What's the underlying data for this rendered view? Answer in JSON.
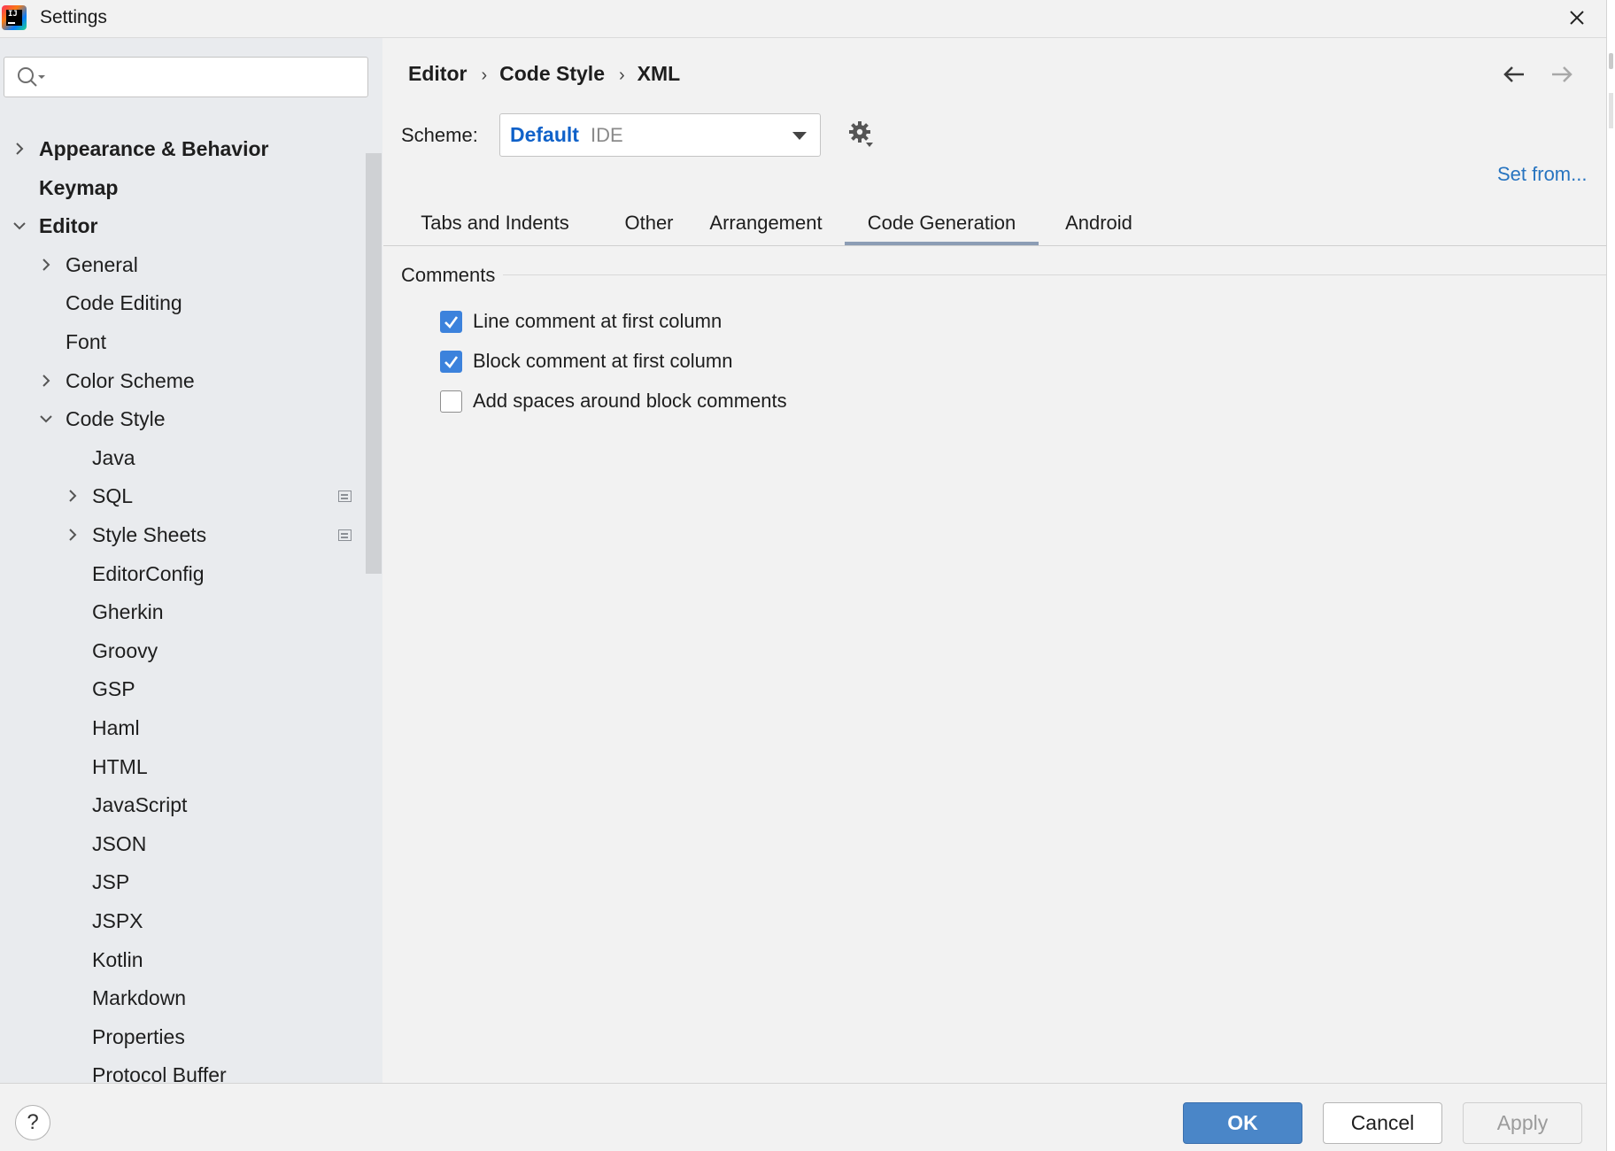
{
  "window": {
    "title": "Settings"
  },
  "search": {
    "placeholder": "",
    "value": ""
  },
  "sidebar": {
    "items": [
      {
        "label": "Appearance & Behavior",
        "level": 0,
        "expandable": true,
        "expanded": false,
        "bold": true,
        "project": false
      },
      {
        "label": "Keymap",
        "level": 0,
        "expandable": false,
        "expanded": false,
        "bold": true,
        "project": false
      },
      {
        "label": "Editor",
        "level": 0,
        "expandable": true,
        "expanded": true,
        "bold": true,
        "project": false
      },
      {
        "label": "General",
        "level": 1,
        "expandable": true,
        "expanded": false,
        "bold": false,
        "project": false
      },
      {
        "label": "Code Editing",
        "level": 1,
        "expandable": false,
        "expanded": false,
        "bold": false,
        "project": false
      },
      {
        "label": "Font",
        "level": 1,
        "expandable": false,
        "expanded": false,
        "bold": false,
        "project": false
      },
      {
        "label": "Color Scheme",
        "level": 1,
        "expandable": true,
        "expanded": false,
        "bold": false,
        "project": false
      },
      {
        "label": "Code Style",
        "level": 1,
        "expandable": true,
        "expanded": true,
        "bold": false,
        "project": false
      },
      {
        "label": "Java",
        "level": 2,
        "expandable": false,
        "expanded": false,
        "bold": false,
        "project": false
      },
      {
        "label": "SQL",
        "level": 2,
        "expandable": true,
        "expanded": false,
        "bold": false,
        "project": true
      },
      {
        "label": "Style Sheets",
        "level": 2,
        "expandable": true,
        "expanded": false,
        "bold": false,
        "project": true
      },
      {
        "label": "EditorConfig",
        "level": 2,
        "expandable": false,
        "expanded": false,
        "bold": false,
        "project": false
      },
      {
        "label": "Gherkin",
        "level": 2,
        "expandable": false,
        "expanded": false,
        "bold": false,
        "project": false
      },
      {
        "label": "Groovy",
        "level": 2,
        "expandable": false,
        "expanded": false,
        "bold": false,
        "project": false
      },
      {
        "label": "GSP",
        "level": 2,
        "expandable": false,
        "expanded": false,
        "bold": false,
        "project": false
      },
      {
        "label": "Haml",
        "level": 2,
        "expandable": false,
        "expanded": false,
        "bold": false,
        "project": false
      },
      {
        "label": "HTML",
        "level": 2,
        "expandable": false,
        "expanded": false,
        "bold": false,
        "project": false
      },
      {
        "label": "JavaScript",
        "level": 2,
        "expandable": false,
        "expanded": false,
        "bold": false,
        "project": false
      },
      {
        "label": "JSON",
        "level": 2,
        "expandable": false,
        "expanded": false,
        "bold": false,
        "project": false
      },
      {
        "label": "JSP",
        "level": 2,
        "expandable": false,
        "expanded": false,
        "bold": false,
        "project": false
      },
      {
        "label": "JSPX",
        "level": 2,
        "expandable": false,
        "expanded": false,
        "bold": false,
        "project": false
      },
      {
        "label": "Kotlin",
        "level": 2,
        "expandable": false,
        "expanded": false,
        "bold": false,
        "project": false
      },
      {
        "label": "Markdown",
        "level": 2,
        "expandable": false,
        "expanded": false,
        "bold": false,
        "project": false
      },
      {
        "label": "Properties",
        "level": 2,
        "expandable": false,
        "expanded": false,
        "bold": false,
        "project": false
      },
      {
        "label": "Protocol Buffer",
        "level": 2,
        "expandable": false,
        "expanded": false,
        "bold": false,
        "project": false
      }
    ]
  },
  "breadcrumb": [
    "Editor",
    "Code Style",
    "XML"
  ],
  "nav": {
    "back_icon": "arrow-left-icon",
    "forward_icon": "arrow-right-icon",
    "forward_enabled": false
  },
  "scheme": {
    "label": "Scheme:",
    "name": "Default",
    "kind": "IDE",
    "gear_icon": "gear-icon"
  },
  "set_from": "Set from...",
  "tabs": [
    {
      "label": "Tabs and Indents",
      "active": false
    },
    {
      "label": "Other",
      "active": false
    },
    {
      "label": "Arrangement",
      "active": false
    },
    {
      "label": "Code Generation",
      "active": true
    },
    {
      "label": "Android",
      "active": false
    }
  ],
  "comments": {
    "title": "Comments",
    "options": [
      {
        "label": "Line comment at first column",
        "checked": true
      },
      {
        "label": "Block comment at first column",
        "checked": true
      },
      {
        "label": "Add spaces around block comments",
        "checked": false
      }
    ]
  },
  "footer": {
    "help": "?",
    "ok": "OK",
    "cancel": "Cancel",
    "apply": "Apply",
    "apply_enabled": false
  },
  "colors": {
    "accent": "#4a86c8",
    "link": "#2774c0",
    "checkbox": "#3c82dc",
    "scheme_name": "#0f61c9"
  }
}
